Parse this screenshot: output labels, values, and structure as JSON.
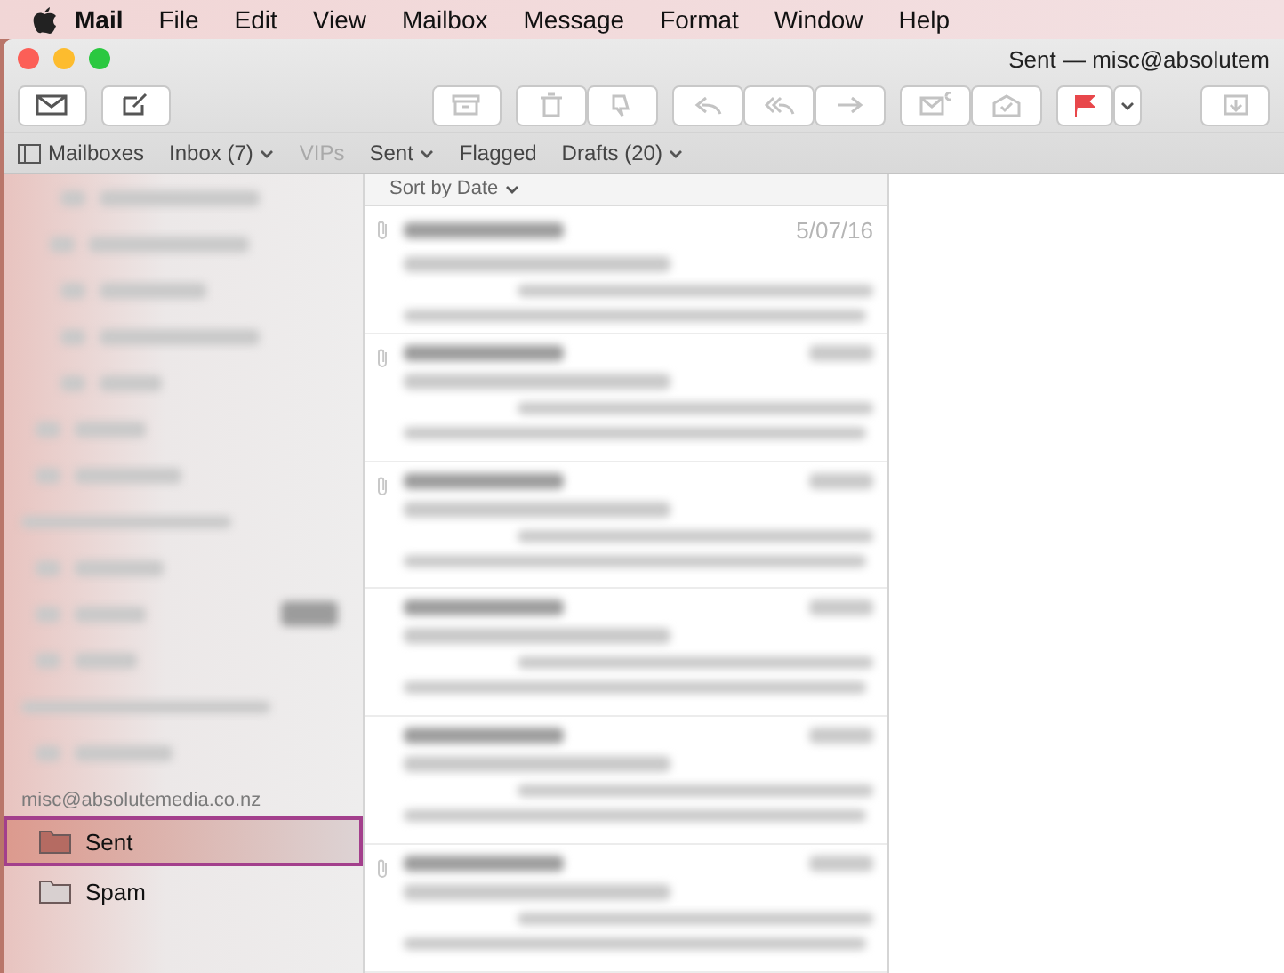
{
  "menu_bar": {
    "app": "Mail",
    "items": [
      "File",
      "Edit",
      "View",
      "Mailbox",
      "Message",
      "Format",
      "Window",
      "Help"
    ]
  },
  "window": {
    "title": "Sent — misc@absolutem"
  },
  "favorites_bar": [
    {
      "label": "Mailboxes",
      "kind": "toggle",
      "dropdown": false,
      "disabled": false
    },
    {
      "label": "Inbox (7)",
      "kind": "mailbox",
      "dropdown": true,
      "disabled": false
    },
    {
      "label": "VIPs",
      "kind": "mailbox",
      "dropdown": false,
      "disabled": true
    },
    {
      "label": "Sent",
      "kind": "mailbox",
      "dropdown": true,
      "disabled": false
    },
    {
      "label": "Flagged",
      "kind": "mailbox",
      "dropdown": false,
      "disabled": false
    },
    {
      "label": "Drafts (20)",
      "kind": "mailbox",
      "dropdown": true,
      "disabled": false
    }
  ],
  "message_list": {
    "sort": "Sort by Date",
    "messages": [
      {
        "attachment": true,
        "date": "5/07/16"
      },
      {
        "attachment": true
      },
      {
        "attachment": true
      },
      {
        "attachment": false
      },
      {
        "attachment": false
      },
      {
        "attachment": true
      }
    ]
  },
  "sidebar": {
    "account": "misc@absolutemedia.co.nz",
    "mailboxes": [
      {
        "name": "Sent",
        "selected": true
      },
      {
        "name": "Spam",
        "selected": false
      }
    ]
  }
}
